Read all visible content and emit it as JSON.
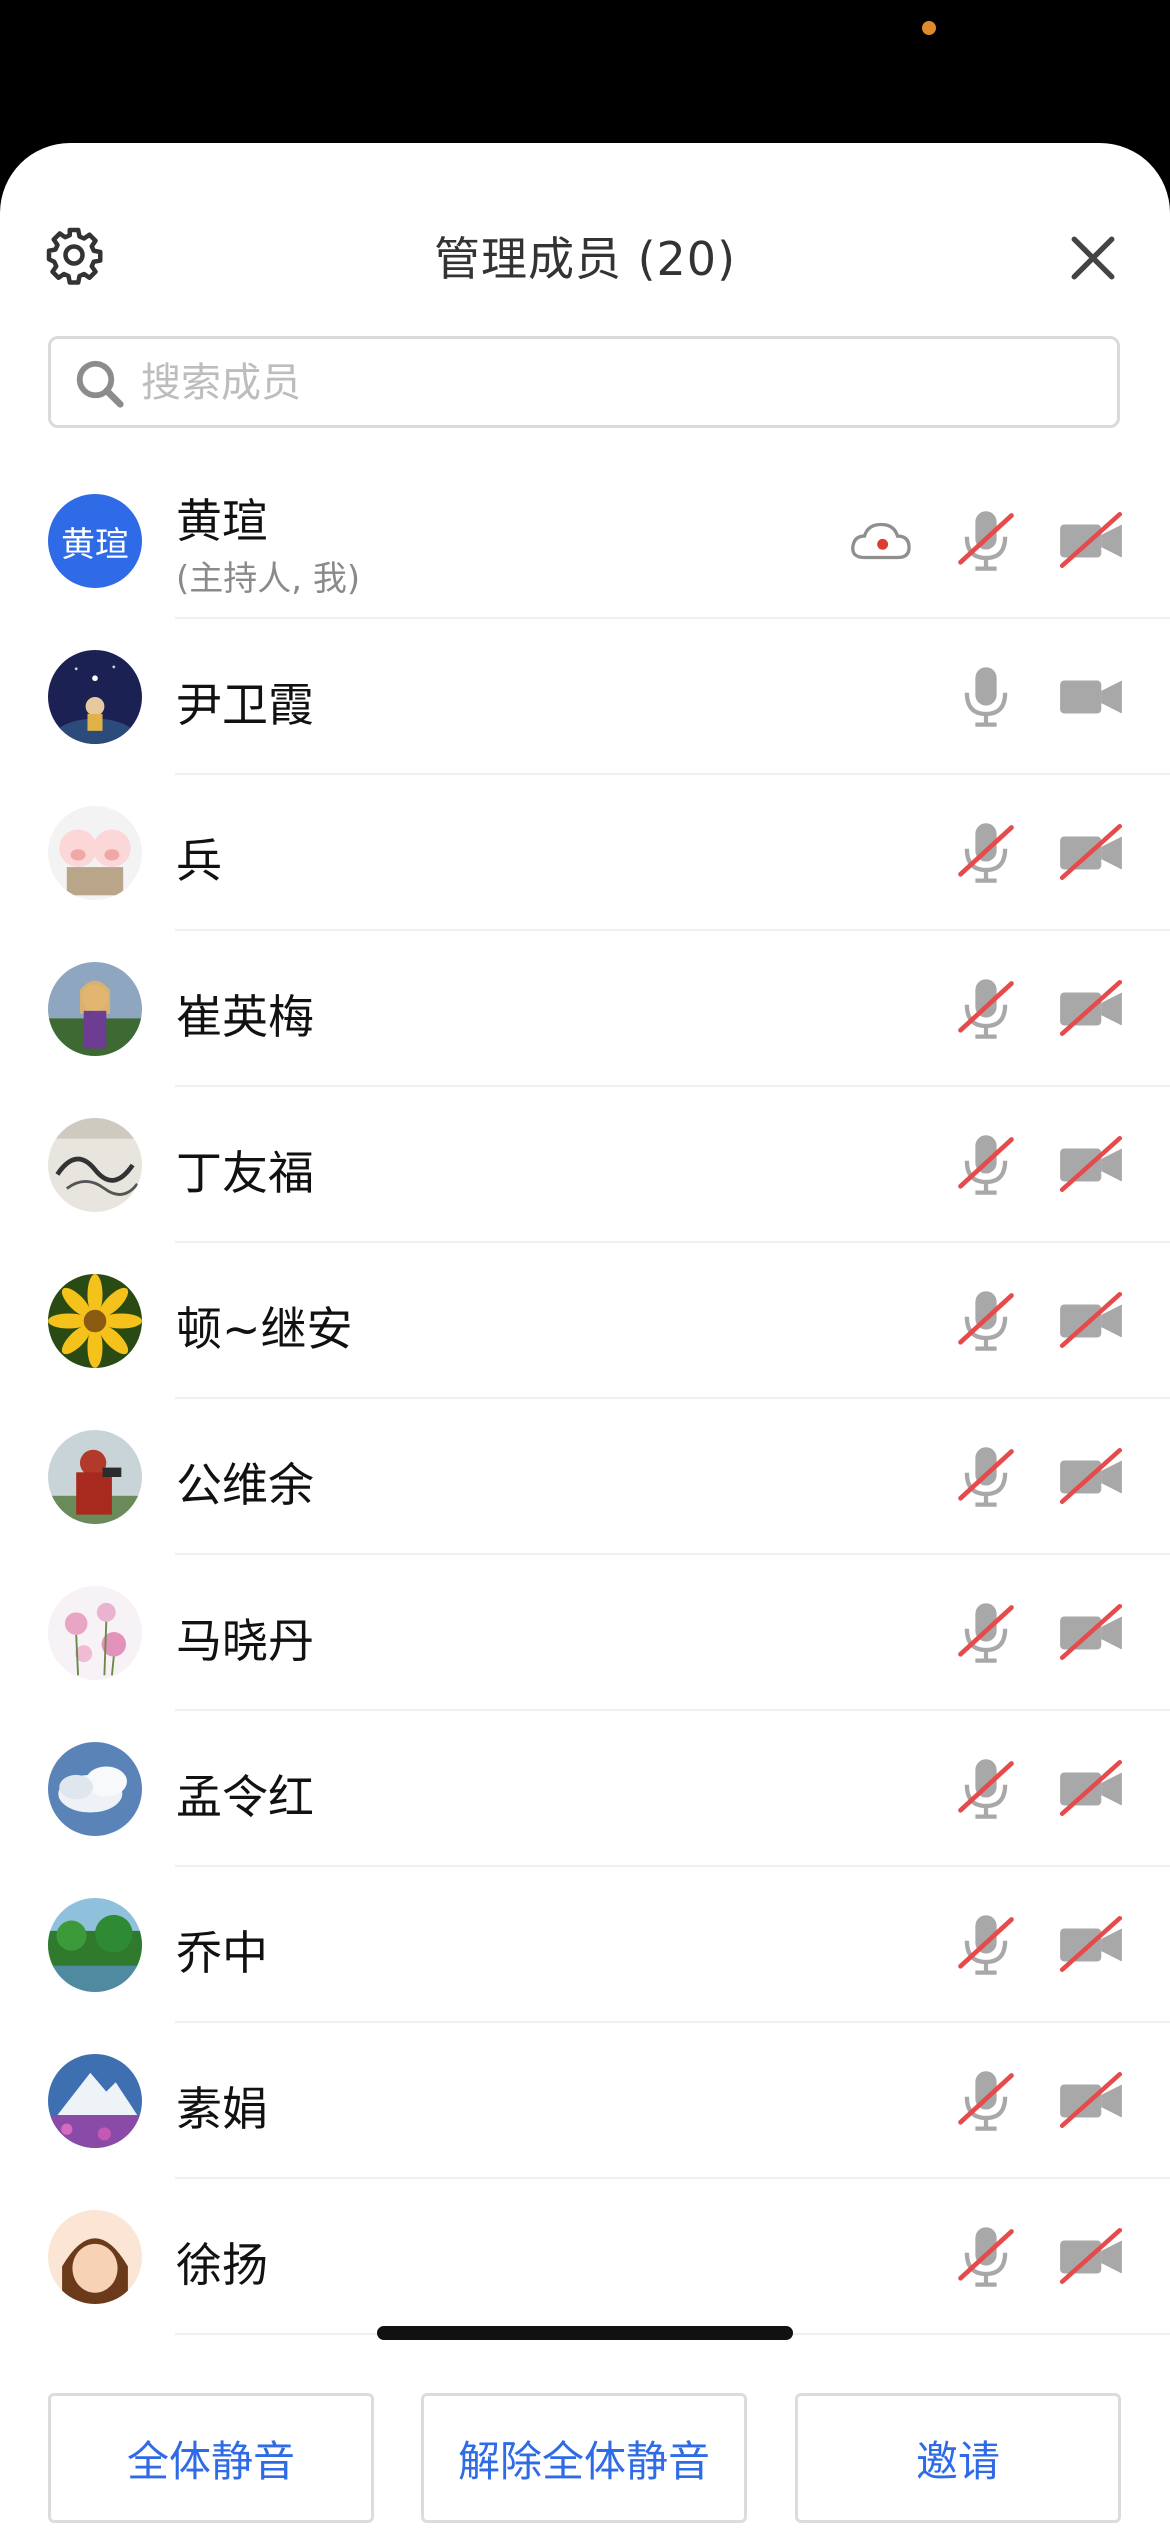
{
  "header": {
    "title": "管理成员 (20)"
  },
  "search": {
    "placeholder": "搜索成员"
  },
  "colors": {
    "accent": "#2f6be6",
    "muted_red": "#e54b4b",
    "icon_gray": "#9a9a9a"
  },
  "members": [
    {
      "name": "黄瑄",
      "role": "(主持人, 我)",
      "avatar_text": "黄瑄",
      "recording": true,
      "mic": "muted",
      "camera": "off"
    },
    {
      "name": "尹卫霞",
      "mic": "on",
      "camera": "on",
      "avatar": "night-sky-figure"
    },
    {
      "name": "兵",
      "mic": "muted",
      "camera": "off",
      "avatar": "pigs-cartoon"
    },
    {
      "name": "崔英梅",
      "mic": "muted",
      "camera": "off",
      "avatar": "woman-photo"
    },
    {
      "name": "丁友福",
      "mic": "muted",
      "camera": "off",
      "avatar": "ink-painting"
    },
    {
      "name": "顿~继安",
      "mic": "muted",
      "camera": "off",
      "avatar": "yellow-flower"
    },
    {
      "name": "公维余",
      "mic": "muted",
      "camera": "off",
      "avatar": "red-statue"
    },
    {
      "name": "马晓丹",
      "mic": "muted",
      "camera": "off",
      "avatar": "pink-flowers"
    },
    {
      "name": "孟令红",
      "mic": "muted",
      "camera": "off",
      "avatar": "clouds"
    },
    {
      "name": "乔中",
      "mic": "muted",
      "camera": "off",
      "avatar": "green-garden"
    },
    {
      "name": "素娟",
      "mic": "muted",
      "camera": "off",
      "avatar": "mountain-flowers"
    },
    {
      "name": "徐扬",
      "mic": "muted",
      "camera": "off",
      "avatar": "cartoon-girl"
    }
  ],
  "actions": {
    "mute_all": "全体静音",
    "unmute_all": "解除全体静音",
    "invite": "邀请"
  }
}
